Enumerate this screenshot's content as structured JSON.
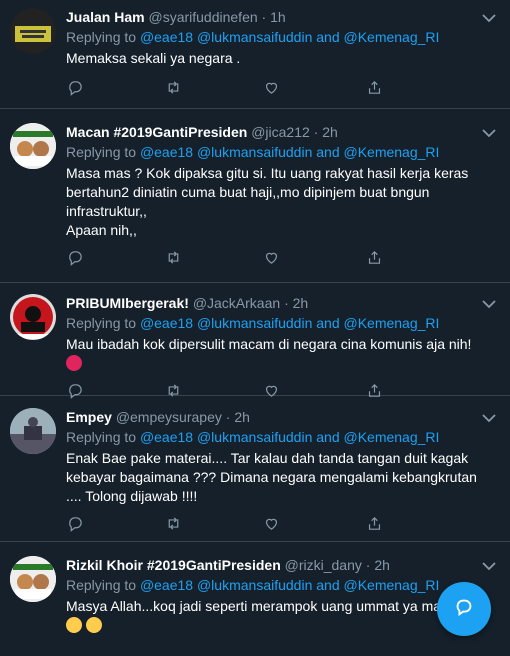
{
  "tweets": [
    {
      "name": "Jualan Ham",
      "handle": "@syarifuddinefen",
      "time": "1h",
      "replying_prefix": "Replying to",
      "mentions_text": "@eae18 @lukmansaifuddin and @Kemenag_RI",
      "body": "Memaksa sekali ya negara ."
    },
    {
      "name": "Macan #2019GantiPresiden",
      "handle": "@jica212",
      "time": "2h",
      "replying_prefix": "Replying to",
      "mentions_text": "@eae18 @lukmansaifuddin and @Kemenag_RI",
      "body": "Masa mas ?  Kok dipaksa gitu si. Itu uang rakyat hasil kerja keras bertahun2 diniatin cuma buat haji,,mo dipinjem buat bngun infrastruktur,,",
      "body2": "Apaan nih,,"
    },
    {
      "name": "PRIBUMIbergerak!",
      "handle": "@JackArkaan",
      "time": "2h",
      "replying_prefix": "Replying to",
      "mentions_text": "@eae18 @lukmansaifuddin and @Kemenag_RI",
      "body": "Mau ibadah kok dipersulit macam di negara cina komunis aja nih!"
    },
    {
      "name": "Empey",
      "handle": "@empeysurapey",
      "time": "2h",
      "replying_prefix": "Replying to",
      "mentions_text": "@eae18 @lukmansaifuddin and @Kemenag_RI",
      "body": "Enak Bae pake materai.... Tar kalau dah tanda tangan duit kagak kebayar bagaimana ??? Dimana negara mengalami kebangkrutan .... Tolong dijawab !!!!"
    },
    {
      "name": "Rizkil Khoir #2019GantiPresiden",
      "handle": "@rizki_dany",
      "time": "2h",
      "replying_prefix": "Replying to",
      "mentions_text": "@eae18 @lukmansaifuddin and @Kemenag_RI",
      "body": "Masya Allah...koq jadi seperti merampok uang ummat ya ma"
    }
  ],
  "dot": "·",
  "colors": {
    "background": "#15202b",
    "accent": "#1da1f2",
    "muted": "#8899a6",
    "divider": "#38444d"
  },
  "icons": [
    "reply-icon",
    "retweet-icon",
    "like-icon",
    "share-icon",
    "chevron-down-icon",
    "compose-icon"
  ]
}
